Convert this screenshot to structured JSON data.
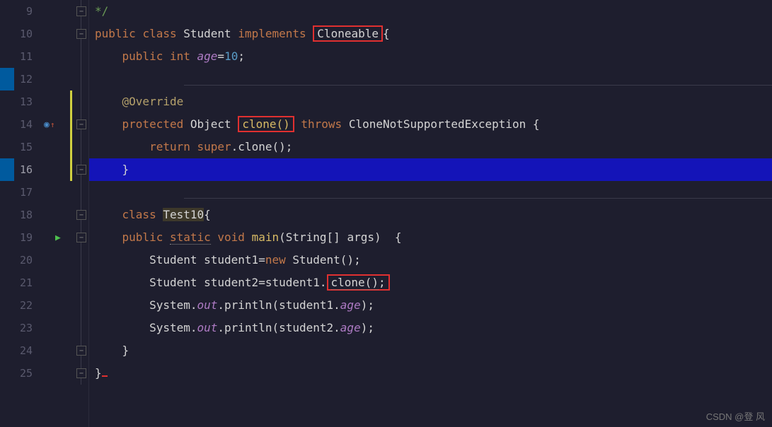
{
  "lines": {
    "start": 9,
    "end": 25
  },
  "code": {
    "l9": "*/",
    "l10_public": "public",
    "l10_class": "class",
    "l10_student": "Student",
    "l10_implements": "implements",
    "l10_cloneable": "Cloneable",
    "l10_brace": "{",
    "l11_public": "public",
    "l11_int": "int",
    "l11_age": "age",
    "l11_eq": "=",
    "l11_val": "10",
    "l11_semi": ";",
    "l13_anno": "@Override",
    "l14_protected": "protected",
    "l14_object": "Object",
    "l14_clone": "clone()",
    "l14_throws": "throws",
    "l14_exc": "CloneNotSupportedException",
    "l14_brace": "{",
    "l15_return": "return",
    "l15_super": "super",
    "l15_clone": ".clone();",
    "l16_brace": "}",
    "l18_class": "class",
    "l18_test": "Test10",
    "l18_brace": "{",
    "l19_public": "public",
    "l19_static": "static",
    "l19_void": "void",
    "l19_main": "main",
    "l19_params": "(String[] args)  {",
    "l20": "Student student1=",
    "l20_new": "new",
    "l20_rest": " Student();",
    "l21_a": "Student student2=student1.",
    "l21_clone": "clone()",
    "l21_semi": ";",
    "l22_a": "System.",
    "l22_out": "out",
    "l22_b": ".println(student1.",
    "l22_age": "age",
    "l22_c": ");",
    "l23_a": "System.",
    "l23_out": "out",
    "l23_b": ".println(student2.",
    "l23_age": "age",
    "l23_c": ");",
    "l24": "}",
    "l25": "}"
  },
  "line_numbers": [
    "9",
    "10",
    "11",
    "12",
    "13",
    "14",
    "15",
    "16",
    "17",
    "18",
    "19",
    "20",
    "21",
    "22",
    "23",
    "24",
    "25"
  ],
  "watermark": "CSDN @登 风"
}
